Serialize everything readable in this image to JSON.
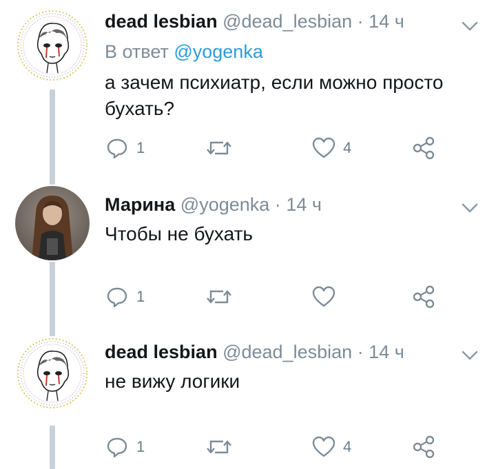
{
  "colors": {
    "link": "#2b9bd9",
    "muted": "#7c8b97",
    "thread_line": "#c8d1d9"
  },
  "tweets": [
    {
      "name": "dead lesbian",
      "handle": "@dead_lesbian",
      "separator": "·",
      "time": "14 ч",
      "reply_prefix": "В ответ",
      "reply_to": "@yogenka",
      "text": "а зачем психиатр, если можно просто бухать?",
      "replies": "1",
      "retweets": "",
      "likes": "4",
      "avatar_icon": "portrait-drawing-icon"
    },
    {
      "name": "Марина",
      "handle": "@yogenka",
      "separator": "·",
      "time": "14 ч",
      "text": "Чтобы не бухать",
      "replies": "1",
      "retweets": "",
      "likes": "",
      "avatar_icon": "photo-avatar-icon"
    },
    {
      "name": "dead lesbian",
      "handle": "@dead_lesbian",
      "separator": "·",
      "time": "14 ч",
      "text": "не вижу логики",
      "replies": "1",
      "retweets": "",
      "likes": "4",
      "avatar_icon": "portrait-drawing-icon"
    }
  ]
}
